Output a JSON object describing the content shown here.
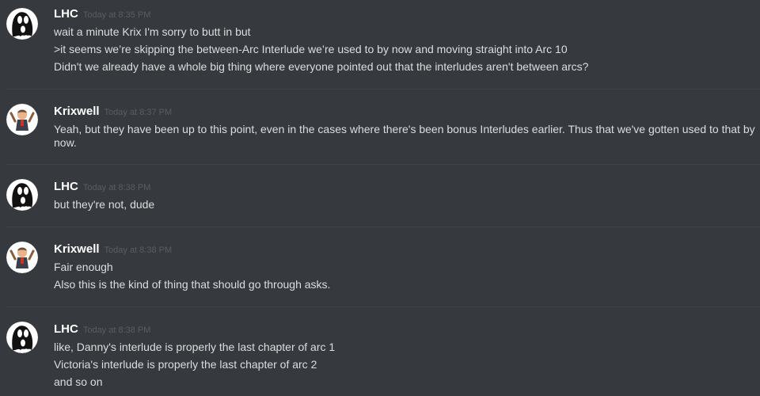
{
  "colors": {
    "background": "#36393e",
    "username": "#ffffff",
    "timestamp": "#5a5d62",
    "message_text": "#dcddde",
    "divider": "#3f4247"
  },
  "groups": [
    {
      "author": "LHC",
      "timestamp": "Today at 8:35 PM",
      "avatar_icon": "ghost-avatar-icon",
      "messages": [
        "wait a minute Krix I'm sorry to butt in but",
        ">it seems we’re skipping the between-Arc Interlude we’re used to by now and moving straight into Arc 10",
        "Didn't we already have a whole big thing where everyone pointed out that the interludes aren't between arcs?"
      ]
    },
    {
      "author": "Krixwell",
      "timestamp": "Today at 8:37 PM",
      "avatar_icon": "cartoon-character-avatar-icon",
      "messages": [
        "Yeah, but they have been up to this point, even in the cases where there's been bonus Interludes earlier. Thus that we've gotten used to that by now."
      ]
    },
    {
      "author": "LHC",
      "timestamp": "Today at 8:38 PM",
      "avatar_icon": "ghost-avatar-icon",
      "messages": [
        "but they're not, dude"
      ]
    },
    {
      "author": "Krixwell",
      "timestamp": "Today at 8:38 PM",
      "avatar_icon": "cartoon-character-avatar-icon",
      "messages": [
        "Fair enough",
        "Also this is the kind of thing that should go through asks."
      ]
    },
    {
      "author": "LHC",
      "timestamp": "Today at 8:38 PM",
      "avatar_icon": "ghost-avatar-icon",
      "messages": [
        "like, Danny's interlude is properly the last chapter of arc 1",
        "Victoria's interlude is properly the last chapter of arc 2",
        "and so on"
      ]
    }
  ]
}
